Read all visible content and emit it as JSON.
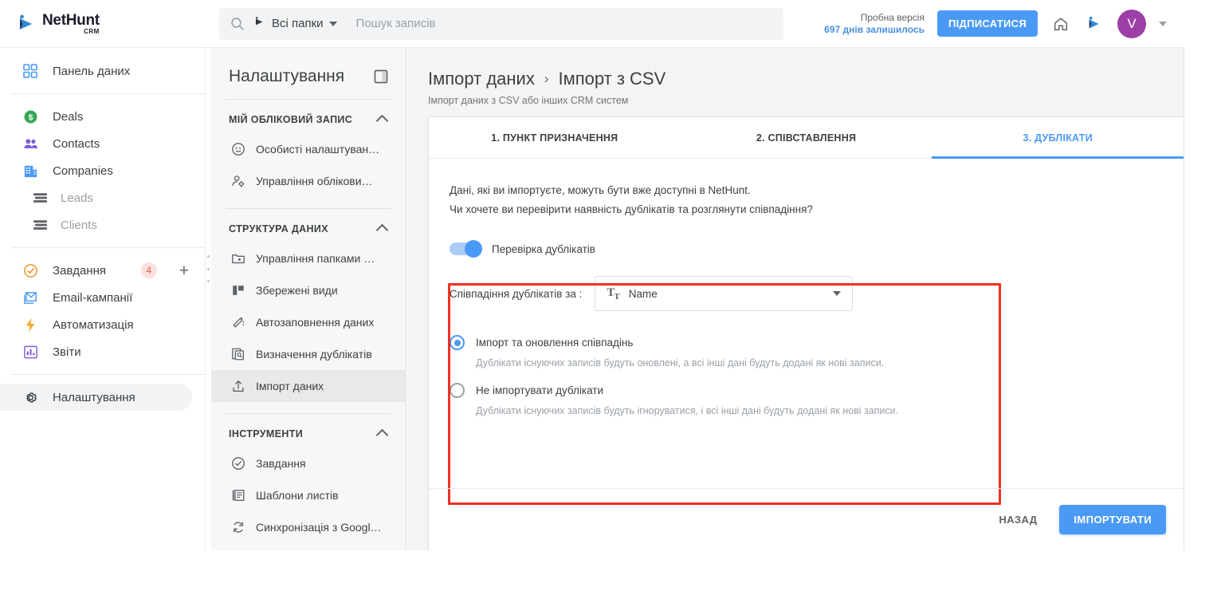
{
  "brand": {
    "name": "NetHunt",
    "sub": "CRM",
    "accent": "#4a9af5"
  },
  "topbar": {
    "search": {
      "folder_label": "Всі папки",
      "placeholder": "Пошук записів",
      "value": ""
    },
    "trial_line1": "Пробна версія",
    "trial_line2": "697 днів залишилось",
    "subscribe_label": "ПІДПИСАТИСЯ",
    "home_icon": "home-icon",
    "app_icon": "nethunt-icon",
    "avatar_initial": "V"
  },
  "leftnav": {
    "groups": [
      {
        "items": [
          {
            "label": "Панель даних",
            "icon": "dashboard-icon"
          }
        ]
      },
      {
        "items": [
          {
            "label": "Deals",
            "icon": "deals-icon"
          },
          {
            "label": "Contacts",
            "icon": "contacts-icon"
          },
          {
            "label": "Companies",
            "icon": "companies-icon"
          },
          {
            "label": "Leads",
            "icon": "list-icon",
            "sub": true
          },
          {
            "label": "Clients",
            "icon": "list-icon",
            "sub": true
          }
        ]
      },
      {
        "items": [
          {
            "label": "Завдання",
            "icon": "tasks-icon",
            "badge": "4",
            "plus": "+"
          },
          {
            "label": "Email-кампанії",
            "icon": "email-icon"
          },
          {
            "label": "Автоматизація",
            "icon": "automation-icon"
          },
          {
            "label": "Звіти",
            "icon": "reports-icon"
          }
        ]
      },
      {
        "items": [
          {
            "label": "Налаштування",
            "icon": "gear-icon",
            "active": true
          }
        ]
      }
    ]
  },
  "settings_panel": {
    "title": "Налаштування",
    "collapse_icon": "panel-collapse-icon",
    "sections": [
      {
        "title": "МІЙ ОБЛІКОВИЙ ЗАПИС",
        "items": [
          {
            "label": "Особисті налаштуван…",
            "icon": "profile-icon"
          },
          {
            "label": "Управління обліко­ви…",
            "icon": "user-manage-icon"
          }
        ]
      },
      {
        "title": "СТРУКТУРА ДАНИХ",
        "items": [
          {
            "label": "Управління папками …",
            "icon": "folder-settings-icon"
          },
          {
            "label": "Збережені види",
            "icon": "saved-views-icon"
          },
          {
            "label": "Автозаповнення даних",
            "icon": "autofill-icon"
          },
          {
            "label": "Визначення дублікатів",
            "icon": "duplicates-icon"
          },
          {
            "label": "Імпорт даних",
            "icon": "import-icon",
            "active": true
          }
        ]
      },
      {
        "title": "ІНСТРУМЕНТИ",
        "items": [
          {
            "label": "Завдання",
            "icon": "check-circle-icon"
          },
          {
            "label": "Шаблони листів",
            "icon": "templates-icon"
          },
          {
            "label": "Синхронізація з Googl…",
            "icon": "sync-icon"
          }
        ]
      }
    ]
  },
  "main": {
    "breadcrumb": {
      "parent": "Імпорт даних",
      "separator": "›",
      "current": "Імпорт з CSV"
    },
    "subtitle": "Імпорт даних з CSV або інших CRM систем",
    "tabs": [
      {
        "label": "1. ПУНКТ ПРИЗНАЧЕННЯ",
        "active": false
      },
      {
        "label": "2. СПІВСТАВЛЕННЯ",
        "active": false
      },
      {
        "label": "3. ДУБЛІКАТИ",
        "active": true
      }
    ],
    "lead_line1": "Дані, які ви імпортуєте, можуть бути вже доступні в NetHunt.",
    "lead_line2": "Чи хочете ви перевірити наявність дублікатів та розглянути співпадіння?",
    "toggle": {
      "label": "Перевірка дублікатів",
      "on": true
    },
    "select": {
      "label": "Співпадіння дублікатів за :",
      "icon": "text-field-icon",
      "value": "Name"
    },
    "radios": [
      {
        "label": "Імпорт та оновлення співпадінь",
        "desc": "Дублікати існуючих записів будуть оновлені, а всі інші дані будуть додані як нові записи.",
        "selected": true
      },
      {
        "label": "Не імпортувати дублікати",
        "desc": "Дублікати існуючих записів будуть ігноруватися, і всі інші дані будуть додані як нові записи.",
        "selected": false
      }
    ],
    "footer": {
      "back_label": "НАЗАД",
      "import_label": "ІМПОРТУВАТИ"
    },
    "highlight_color": "#ee3124"
  }
}
